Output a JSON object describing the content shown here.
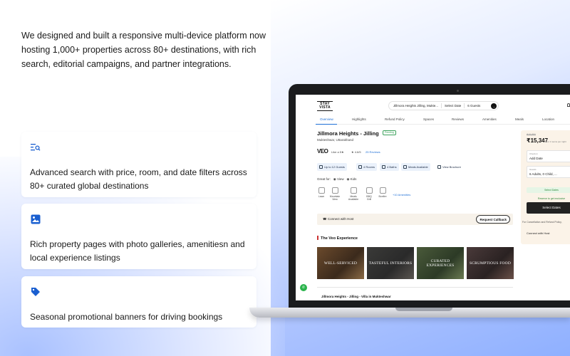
{
  "intro": {
    "text": "We designed and built a responsive multi-device platform now hosting 1,000+ properties across 80+ destinations, with rich search, editorial campaigns, and partner integrations."
  },
  "features": [
    {
      "icon": "search-list-icon",
      "text": "Advanced search with price, room, and date filters across 80+ curated global destinations"
    },
    {
      "icon": "image-icon",
      "text": "Rich property pages with photo galleries, amenitiesn and local experience listings"
    },
    {
      "icon": "tag-icon",
      "text": "Seasonal promotional banners for driving bookings"
    }
  ],
  "site": {
    "logo_line1": "STAY",
    "logo_line2": "VISTA",
    "search_location": "Jillmora Heights Jilling, Mukte...",
    "search_date": "Select Date",
    "search_guests": "6 Guests",
    "tabs": [
      "Overview",
      "Highlights",
      "Refund Policy",
      "Spaces",
      "Reviews",
      "Amenities",
      "Meals",
      "Location"
    ],
    "property_title": "Jillmora Heights - Jilling",
    "pending_badge": "Pending",
    "property_location": "Mukteshwar, Uttarakhand",
    "veo_logo": "VEO",
    "veo_rate": "Like a 5★",
    "veo_stars": "★ 4.6/5",
    "veo_reviews": "25 Reviews",
    "chips": [
      "Up to 12 Guests",
      "4 Rooms",
      "4 Baths",
      "Meals Available",
      "View Brochure"
    ],
    "great_for_label": "Great for:",
    "great_for_items": [
      "View",
      "Kids"
    ],
    "amenities": [
      {
        "line1": "Lawn",
        "line2": ""
      },
      {
        "line1": "Mountain",
        "line2": "View"
      },
      {
        "line1": "Meals",
        "line2": "Available"
      },
      {
        "line1": "BBQ",
        "line2": "Grill"
      },
      {
        "line1": "Bonfire",
        "line2": ""
      }
    ],
    "amenities_more": "+10 Amenities",
    "connect_host": "Connect with Host",
    "request_callback": "Request Callback",
    "experience_title": "The Veo Experience",
    "experiences": [
      "WELL-SERVICED",
      "TASTEFUL INTERIORS",
      "CURATED EXPERIENCES",
      "SCRUMPTIOUS FOOD"
    ],
    "next_section_title": "Jillmora Heights - Jilling - Villa in Mukteshwar",
    "booking": {
      "old_price": "₹18,880",
      "price": "₹15,347",
      "price_sub": "For 4 rooms per night",
      "date_label": "Check-in",
      "date_value": "Add Date",
      "guests_label": "Guests",
      "guests_value": "6 Adults, 0 Child, ...",
      "select_dates_note": "Select Dates",
      "reserve_note": "Reserve to get exclusive",
      "book_button": "Select Dates",
      "cancellation_note": "For Cancellation and Refund Policy,",
      "connect_host": "Connect with Host"
    }
  },
  "colors": {
    "accent": "#1f6fd6",
    "feature_icon": "#1a5fd0",
    "green": "#29b34b"
  }
}
